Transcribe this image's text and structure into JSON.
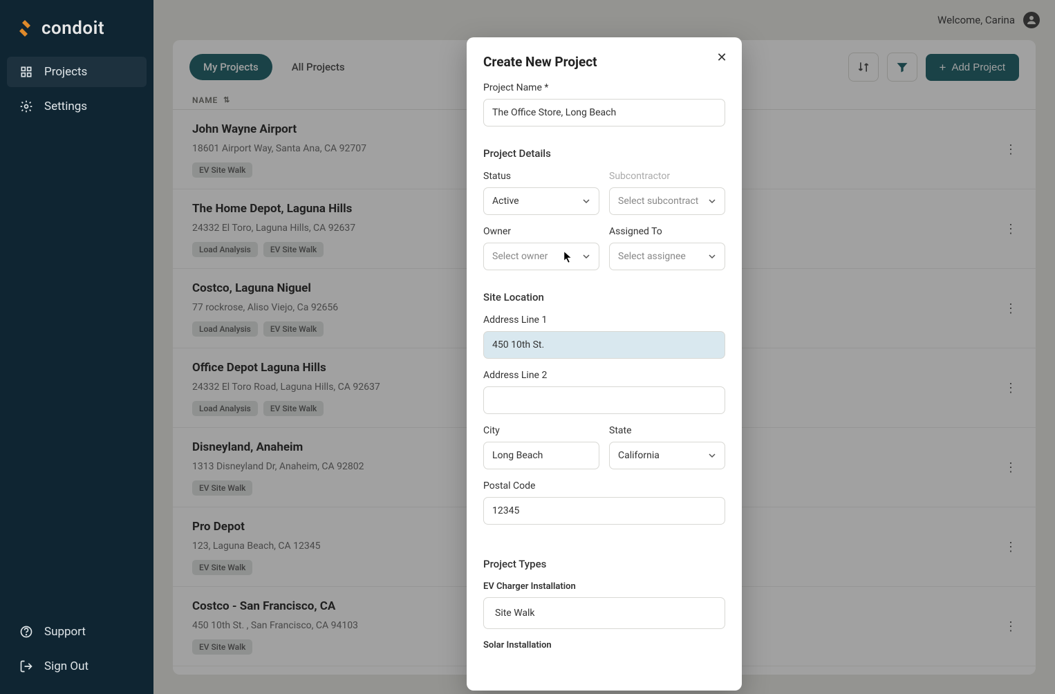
{
  "brand": "condoit",
  "user": {
    "welcome": "Welcome, Carina"
  },
  "sidebar": {
    "items": [
      {
        "label": "Projects"
      },
      {
        "label": "Settings"
      }
    ],
    "bottom": [
      {
        "label": "Support"
      },
      {
        "label": "Sign Out"
      }
    ]
  },
  "toolbar": {
    "tabs": [
      "My Projects",
      "All Projects"
    ],
    "addLabel": "Add Project",
    "table_header": "NAME"
  },
  "projects": [
    {
      "name": "John Wayne Airport",
      "address": "18601 Airport Way, Santa Ana, CA 92707",
      "tags": [
        "EV Site Walk"
      ]
    },
    {
      "name": "The Home Depot, Laguna Hills",
      "address": "24332 El Toro, Laguna Hills, CA 92637",
      "tags": [
        "Load Analysis",
        "EV Site Walk"
      ]
    },
    {
      "name": "Costco, Laguna Niguel",
      "address": "77 rockrose, Aliso Viejo, Ca 92656",
      "tags": [
        "Load Analysis",
        "EV Site Walk"
      ]
    },
    {
      "name": "Office Depot Laguna Hills",
      "address": "24332 El Toro Road, Laguna Hills, CA 92637",
      "tags": [
        "Load Analysis",
        "EV Site Walk"
      ]
    },
    {
      "name": "Disneyland, Anaheim",
      "address": "1313 Disneyland Dr, Anaheim, CA 92802",
      "tags": [
        "EV Site Walk"
      ]
    },
    {
      "name": "Pro Depot",
      "address": "123, Laguna Beach, CA 12345",
      "tags": [
        "EV Site Walk"
      ]
    },
    {
      "name": "Costco - San Francisco, CA",
      "address": "450 10th St. , San Francisco, CA 94103",
      "tags": [
        "EV Site Walk"
      ]
    }
  ],
  "modal": {
    "title": "Create New Project",
    "labels": {
      "projectName": "Project Name *",
      "projectDetails": "Project Details",
      "status": "Status",
      "subcontractor": "Subcontractor",
      "owner": "Owner",
      "assignedTo": "Assigned To",
      "siteLocation": "Site Location",
      "address1": "Address Line 1",
      "address2": "Address Line 2",
      "city": "City",
      "state": "State",
      "postal": "Postal Code",
      "projectTypes": "Project Types",
      "evCharger": "EV Charger Installation",
      "solar": "Solar Installation"
    },
    "values": {
      "projectName": "The Office Store, Long Beach",
      "status": "Active",
      "subcontractor_placeholder": "Select subcontract",
      "owner_placeholder": "Select owner",
      "assigned_placeholder": "Select assignee",
      "address1": "450 10th St.",
      "address2": "",
      "city": "Long Beach",
      "state": "California",
      "postal": "12345",
      "siteWalk": "Site Walk"
    }
  },
  "colors": {
    "sidebar_bg": "#0f2532",
    "accent": "#175c64",
    "page_bg": "#e8e8e4"
  }
}
